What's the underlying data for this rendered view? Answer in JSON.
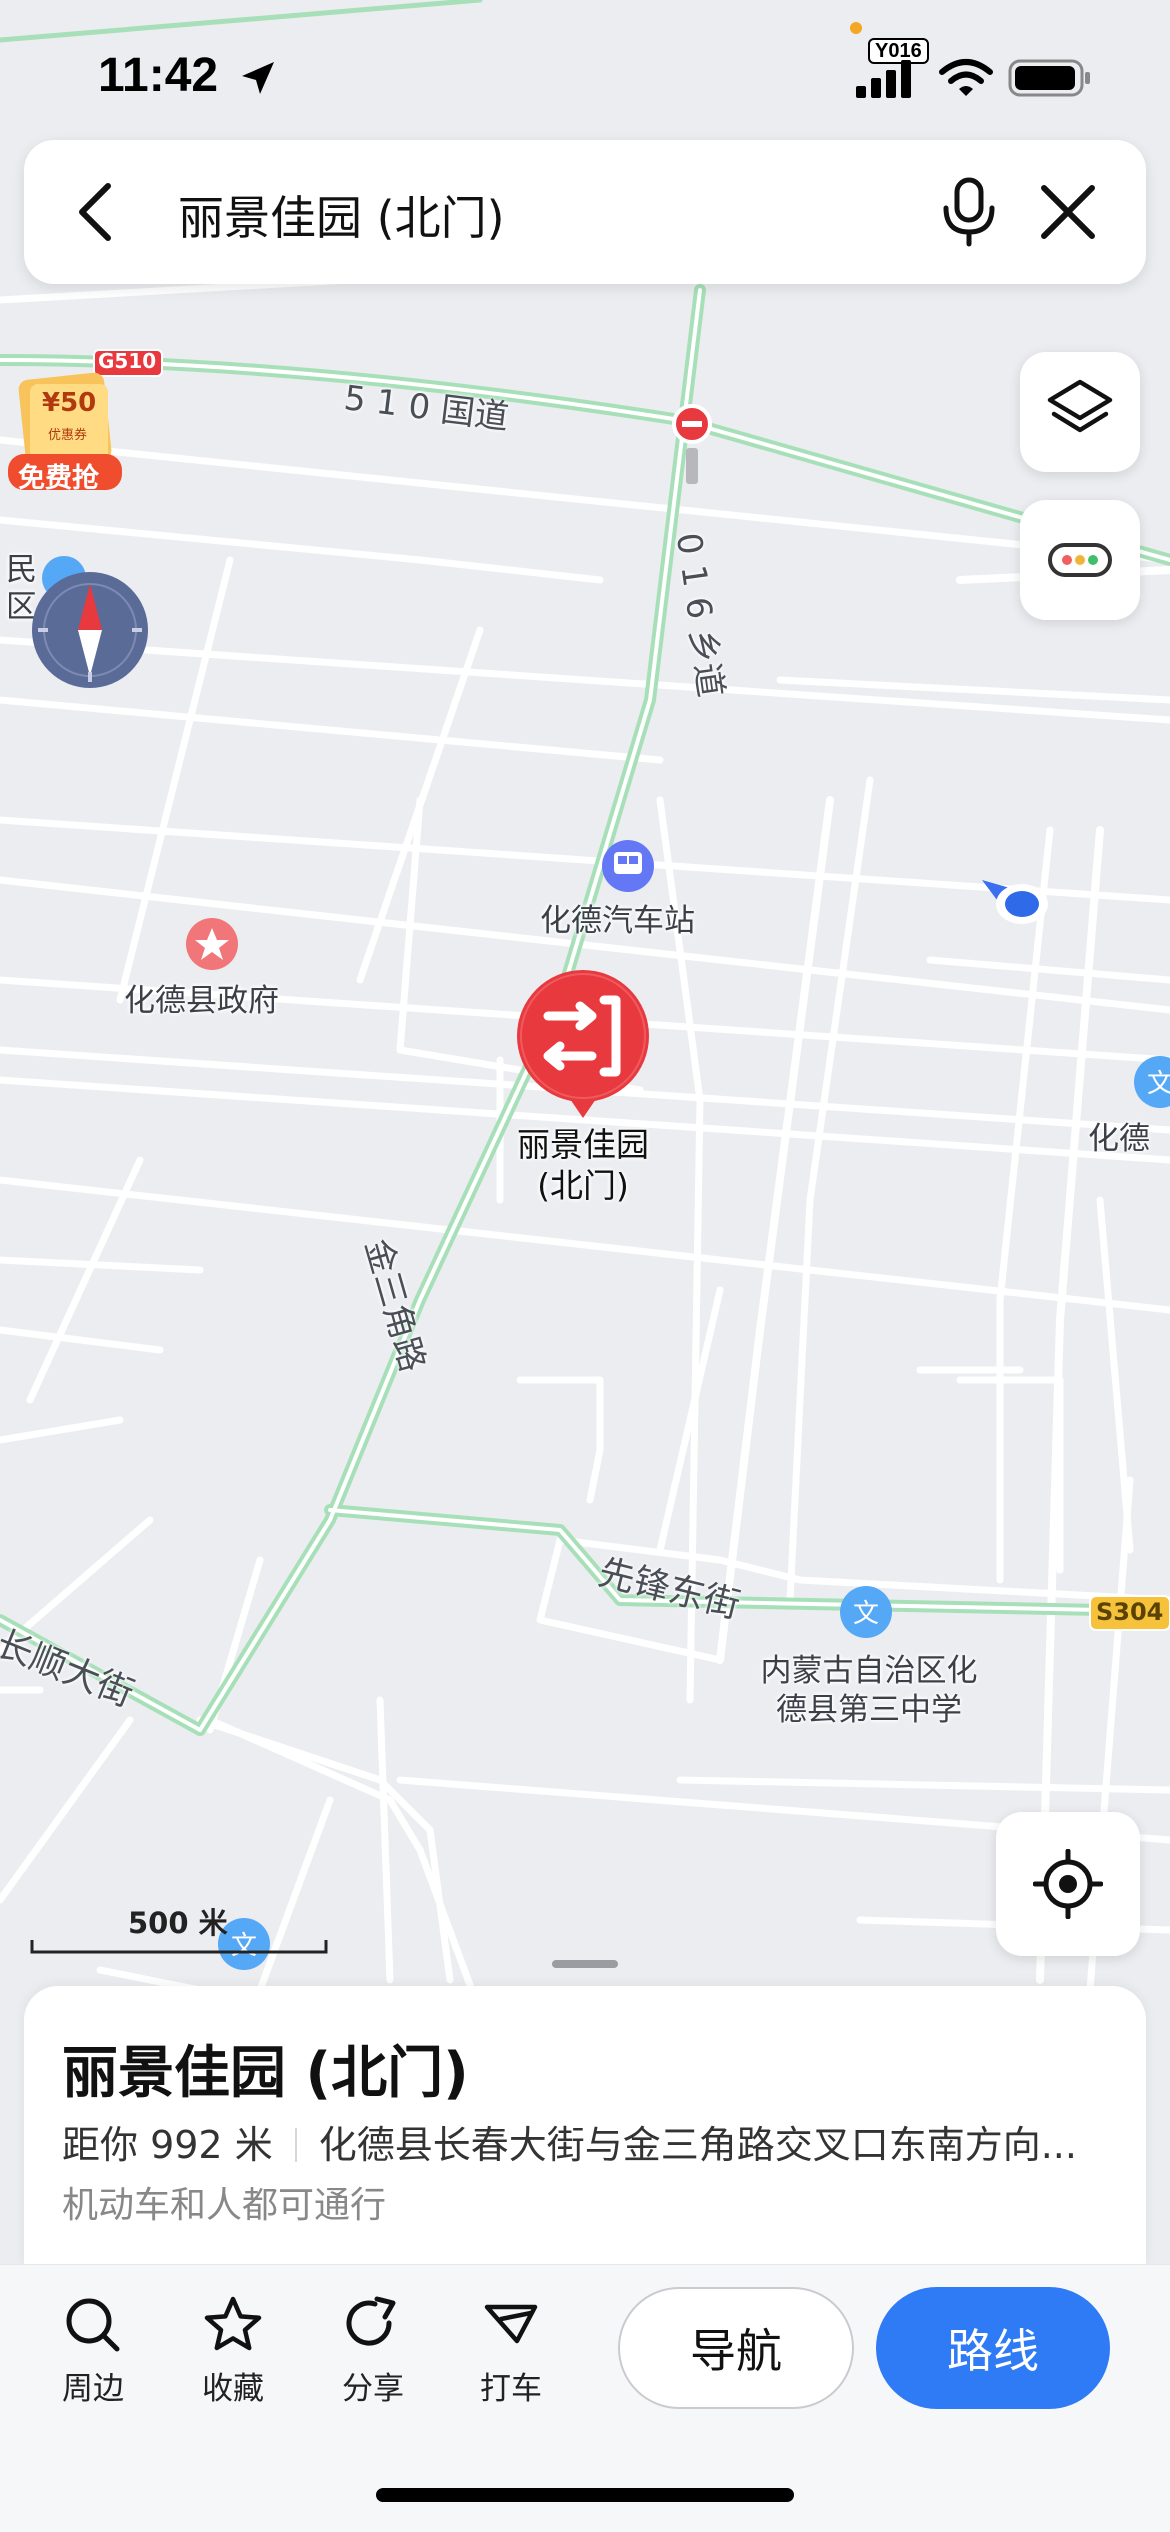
{
  "status_bar": {
    "time": "11:42",
    "carrier_badge": "Y016"
  },
  "search": {
    "query": "丽景佳园 (北门)"
  },
  "map": {
    "road_labels": {
      "g510_shield": "G510",
      "national_road": "5 1 0 国道",
      "township_road": "0 1 6 乡道",
      "jinsanjiao": "金三角路",
      "xianfeng": "先锋东街",
      "changshun": "长顺大街",
      "s304_shield": "S304"
    },
    "pois": {
      "bus_station": "化德汽车站",
      "county_gov": "化德县政府",
      "selected_line1": "丽景佳园",
      "selected_line2": "(北门)",
      "school_line1": "内蒙古自治区化",
      "school_line2": "德县第三中学",
      "edge_right": "化德",
      "edge_left_1": "民",
      "edge_left_2": "区"
    },
    "coupon": {
      "amount": "¥50",
      "tag": "优惠券",
      "label": "免费抢"
    },
    "scale": "500 米",
    "accent_color": "#e8393f",
    "route_color": "#9fdcb0"
  },
  "place_card": {
    "title": "丽景佳园 (北门)",
    "distance": "距你 992 米",
    "address": "化德县长春大街与金三角路交叉口东南方向...",
    "access": "机动车和人都可通行"
  },
  "toolbar": {
    "nearby": "周边",
    "favorite": "收藏",
    "share": "分享",
    "taxi": "打车",
    "navigate": "导航",
    "route": "路线"
  }
}
